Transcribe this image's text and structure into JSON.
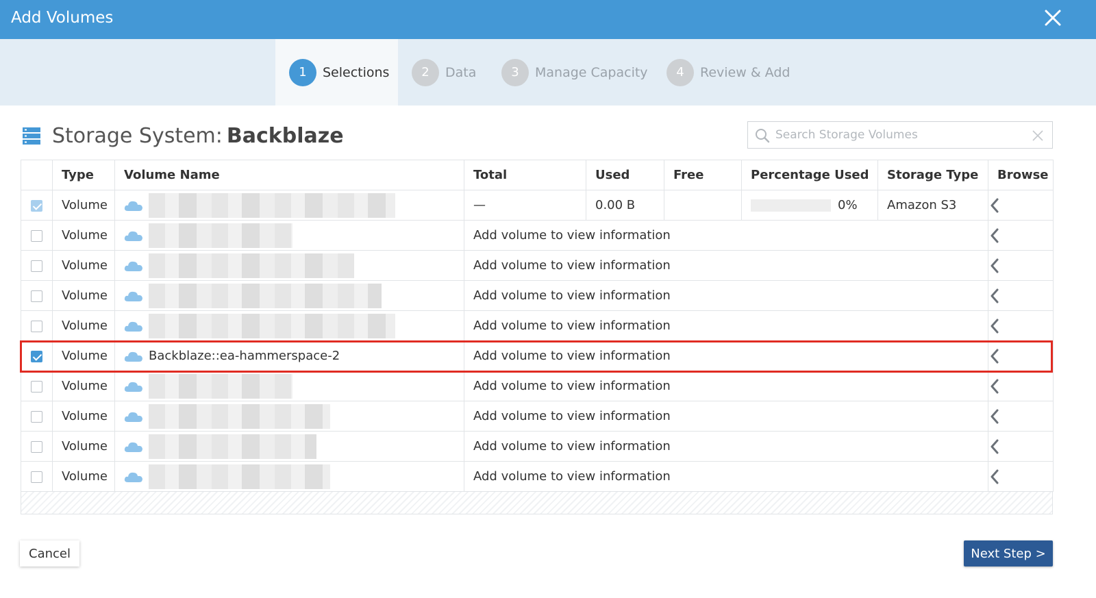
{
  "window": {
    "title": "Add Volumes"
  },
  "steps": [
    {
      "num": "1",
      "label": "Selections",
      "active": true
    },
    {
      "num": "2",
      "label": "Data",
      "active": false
    },
    {
      "num": "3",
      "label": "Manage Capacity",
      "active": false
    },
    {
      "num": "4",
      "label": "Review & Add",
      "active": false
    }
  ],
  "heading": {
    "prefix": "Storage System:",
    "name": "Backblaze"
  },
  "search": {
    "placeholder": "Search Storage Volumes",
    "value": ""
  },
  "table": {
    "headers": [
      "",
      "Type",
      "Volume Name",
      "Total",
      "Used",
      "Free",
      "Percentage Used",
      "Storage Type",
      "Browse"
    ],
    "first_row": {
      "checked": true,
      "type": "Volume",
      "name_redacted": true,
      "total": "—",
      "used": "0.00 B",
      "free": "",
      "percentage_used": "0%",
      "percentage_value": 0,
      "storage_type": "Amazon S3"
    },
    "rows": [
      {
        "checked": false,
        "type": "Volume",
        "name": "",
        "redacted": true,
        "info": "Add volume to view information"
      },
      {
        "checked": false,
        "type": "Volume",
        "name": "",
        "redacted": true,
        "info": "Add volume to view information"
      },
      {
        "checked": false,
        "type": "Volume",
        "name": "",
        "redacted": true,
        "info": "Add volume to view information"
      },
      {
        "checked": false,
        "type": "Volume",
        "name": "",
        "redacted": true,
        "info": "Add volume to view information"
      },
      {
        "checked": true,
        "type": "Volume",
        "name": "Backblaze::ea-hammerspace-2",
        "redacted": false,
        "info": "Add volume to view information",
        "highlighted": true
      },
      {
        "checked": false,
        "type": "Volume",
        "name": "",
        "redacted": true,
        "info": "Add volume to view information"
      },
      {
        "checked": false,
        "type": "Volume",
        "name": "",
        "redacted": true,
        "info": "Add volume to view information"
      },
      {
        "checked": false,
        "type": "Volume",
        "name": "",
        "redacted": true,
        "info": "Add volume to view information"
      },
      {
        "checked": false,
        "type": "Volume",
        "name": "",
        "redacted": true,
        "info": "Add volume to view information"
      }
    ]
  },
  "footer": {
    "cancel_label": "Cancel",
    "next_label": "Next Step >"
  },
  "colors": {
    "header": "#4498d6",
    "accent": "#4498d6",
    "next_button": "#2c5a95",
    "highlight": "#e02b22"
  },
  "icons": {
    "close": "close-icon",
    "storage": "storage-server-icon",
    "search": "search-icon",
    "clear": "clear-icon",
    "cloud": "cloud-icon",
    "browse": "chevron-left-icon"
  }
}
